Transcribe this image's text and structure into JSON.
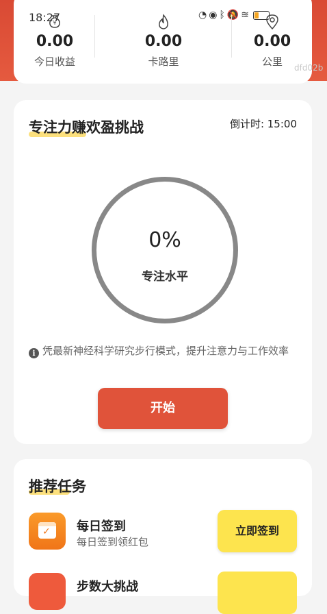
{
  "status_bar": {
    "time": "18:27",
    "icons": [
      "speed-icon",
      "eye-icon",
      "bluetooth-icon",
      "mute-icon",
      "wifi-icon",
      "battery-icon"
    ]
  },
  "stats": [
    {
      "icon": "money-bag-icon",
      "value": "0.00",
      "label": "今日收益"
    },
    {
      "icon": "flame-icon",
      "value": "0.00",
      "label": "卡路里"
    },
    {
      "icon": "location-pin-icon",
      "value": "0.00",
      "label": "公里"
    }
  ],
  "watermark": "dfd02b",
  "focus": {
    "title": "专注力赚欢盈挑战",
    "countdown": "倒计时: 15:00",
    "percent": "0%",
    "level_label": "专注水平",
    "info": "凭最新神经科学研究步行模式，提升注意力与工作效率",
    "start_label": "开始"
  },
  "tasks": {
    "title": "推荐任务",
    "items": [
      {
        "name": "每日签到",
        "desc": "每日签到领红包",
        "action": "立即签到",
        "icon": "calendar-check-icon"
      },
      {
        "name": "步数大挑战",
        "desc": "",
        "action": "",
        "icon": "steps-icon"
      }
    ]
  },
  "colors": {
    "accent": "#e0533a",
    "task_button": "#fde44e",
    "title_highlight": "#fbd85c"
  }
}
